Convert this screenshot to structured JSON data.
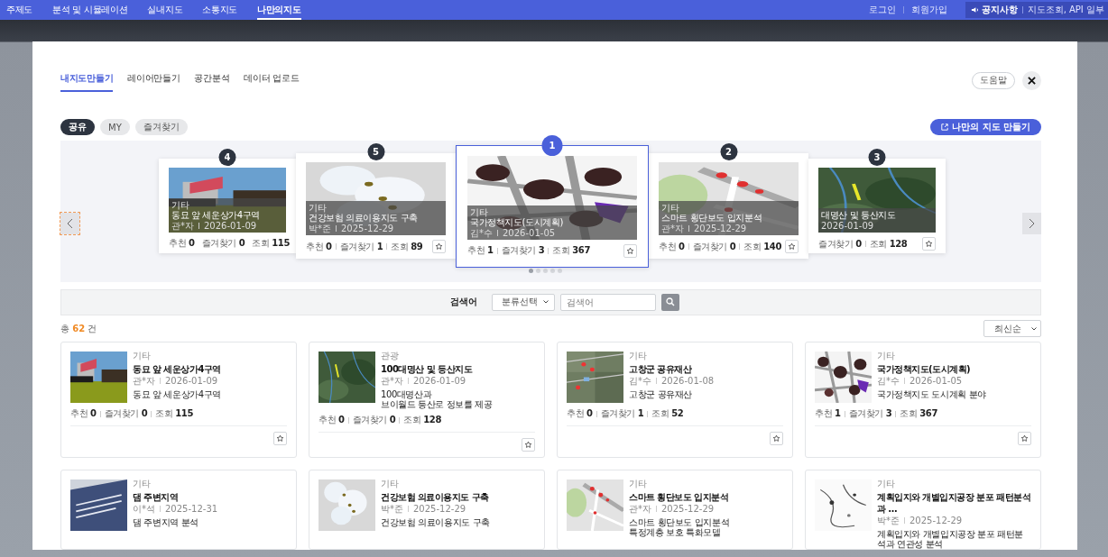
{
  "nav": {
    "items": [
      {
        "label": "주제도",
        "selected": false
      },
      {
        "label": "분석 및 시뮬레이션",
        "selected": false
      },
      {
        "label": "실내지도",
        "selected": false
      },
      {
        "label": "소통지도",
        "selected": false
      },
      {
        "label": "나만의지도",
        "selected": true
      }
    ],
    "links": [
      "로그인",
      "회원가입"
    ],
    "notice": {
      "label": "공지사항",
      "text": "지도조회, API 일부"
    }
  },
  "modal": {
    "tabs": [
      {
        "label": "내지도만들기",
        "selected": true
      },
      {
        "label": "레이어만들기",
        "selected": false
      },
      {
        "label": "공간분석",
        "selected": false
      },
      {
        "label": "데이터 업로드",
        "selected": false
      }
    ],
    "help_button": "도움말",
    "filters": [
      {
        "label": "공유",
        "selected": true
      },
      {
        "label": "MY",
        "selected": false
      },
      {
        "label": "즐겨찾기",
        "selected": false
      }
    ],
    "create_button": "나만의 지도 만들기",
    "carousel": {
      "cards": [
        {
          "kind": "far",
          "rank": "4",
          "selected": false,
          "star_button": false,
          "category": "기타",
          "title": "동묘 앞 세운상가4구역",
          "author": "관*자",
          "date": "2026-01-09",
          "stats": [
            "추천 **0**",
            "즐겨찾기 **0**",
            "조회 **115**"
          ]
        },
        {
          "kind": "near",
          "rank": "5",
          "selected": false,
          "star_button": true,
          "category": "기타",
          "title": "건강보험 의료이용지도 구축",
          "author": "박*준",
          "date": "2025-12-29",
          "stats": [
            "추천 **0**",
            "즐겨찾기 **1**",
            "조회 **89**"
          ]
        },
        {
          "kind": "center",
          "rank": "1",
          "selected": true,
          "star_button": true,
          "category": "기타",
          "title": "국가정책지도(도시계획)",
          "author": "김*수",
          "date": "2026-01-05",
          "stats": [
            "추천 **1**",
            "즐겨찾기 **3**",
            "조회 **367**"
          ]
        },
        {
          "kind": "near",
          "rank": "2",
          "selected": false,
          "star_button": true,
          "category": "기타",
          "title": "스마트 횡단보도 입지분석",
          "author": "관*자",
          "date": "2025-12-29",
          "stats": [
            "추천 **0**",
            "즐겨찾기 **0**",
            "조회 **140**"
          ]
        },
        {
          "kind": "far",
          "rank": "3",
          "selected": false,
          "star_button": true,
          "title": "대명산 및 등산지도",
          "date": "2026-01-09",
          "stats": [
            "즐겨찾기 **0**",
            "조회 **128**"
          ]
        }
      ],
      "dots": [
        {
          "selected": true
        },
        {
          "selected": false
        },
        {
          "selected": false
        },
        {
          "selected": false
        },
        {
          "selected": false
        }
      ]
    },
    "search": {
      "label": "검색어",
      "category": "분류선택",
      "placeholder": "검색어"
    },
    "total": {
      "prefix": "총",
      "count": "62",
      "suffix": "건"
    },
    "sort": "최신순",
    "cards": [
      {
        "category": "기타",
        "title": "동묘 앞 세운상가4구역",
        "author": "관*자",
        "date": "2026-01-09",
        "description": [
          "동묘 앞  세운상가4구역"
        ],
        "stats": [
          "추천 **0**",
          "즐겨찾기 **0**",
          "조회 **115**"
        ]
      },
      {
        "category": "관광",
        "title": "100대명산 및 등산지도",
        "author": "관*자",
        "date": "2026-01-09",
        "description": [
          "100대명산과",
          "브이월드 등산로 정보를 제공"
        ],
        "stats": [
          "추천 **0**",
          "즐겨찾기 **0**",
          "조회 **128**"
        ]
      },
      {
        "category": "기타",
        "title": "고창군 공유재산",
        "author": "김*수",
        "date": "2026-01-08",
        "description": [
          "고창군 공유재산"
        ],
        "stats": [
          "추천 **0**",
          "즐겨찾기 **1**",
          "조회 **52**"
        ]
      },
      {
        "category": "기타",
        "title": "국가정책지도(도시계획)",
        "author": "김*수",
        "date": "2026-01-05",
        "description": [
          "국가정책지도 도시계획 분야"
        ],
        "stats": [
          "추천 **1**",
          "즐겨찾기 **3**",
          "조회 **367**"
        ]
      },
      {
        "category": "기타",
        "title": "댐 주변지역",
        "author": "이*석",
        "date": "2025-12-31",
        "description": [
          "댐 주변지역 분석"
        ]
      },
      {
        "category": "기타",
        "title": "건강보험 의료이용지도 구축",
        "author": "박*준",
        "date": "2025-12-29",
        "description": [
          "건강보험 의료이용지도 구축"
        ]
      },
      {
        "category": "기타",
        "title": "스마트 횡단보도 입지분석",
        "author": "관*자",
        "date": "2025-12-29",
        "description": [
          "스마트 횡단보도 입지분석",
          "특정계층 보호 특화모델"
        ]
      },
      {
        "category": "기타",
        "title": "계획입지와 개별입지공장 분포 패턴분석과 …",
        "author": "박*준",
        "date": "2025-12-29",
        "description": [
          "계획입지와 개별입지공장 분포 패턴분석과 연관성 분석"
        ]
      }
    ]
  }
}
